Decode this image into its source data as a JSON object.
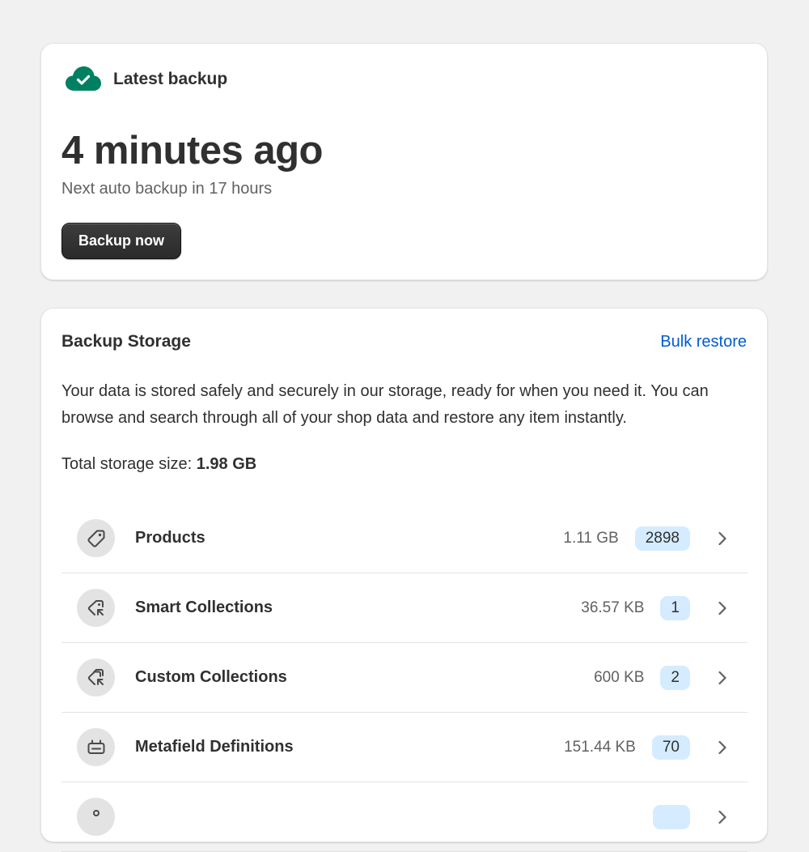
{
  "latest_backup": {
    "title": "Latest backup",
    "time_ago": "4 minutes ago",
    "next_backup": "Next auto backup in 17 hours",
    "backup_button": "Backup now",
    "icon": "cloud-check-icon",
    "icon_color": "#008060"
  },
  "storage": {
    "title": "Backup Storage",
    "bulk_restore": "Bulk restore",
    "description": "Your data is stored safely and securely in our storage, ready for when you need it. You can browse and search through all of your shop data and restore any item instantly.",
    "total_label": "Total storage size: ",
    "total_value": "1.98 GB",
    "link_color": "#005bd3",
    "badge_color": "#d5ebff",
    "items": [
      {
        "label": "Products",
        "size": "1.11 GB",
        "count": "2898",
        "icon": "tag-icon"
      },
      {
        "label": "Smart Collections",
        "size": "36.57 KB",
        "count": "1",
        "icon": "smart-collection-icon"
      },
      {
        "label": "Custom Collections",
        "size": "600 KB",
        "count": "2",
        "icon": "custom-collection-icon"
      },
      {
        "label": "Metafield Definitions",
        "size": "151.44 KB",
        "count": "70",
        "icon": "metafield-icon"
      },
      {
        "label": "",
        "size": "",
        "count": "",
        "icon": "item-icon"
      }
    ]
  }
}
